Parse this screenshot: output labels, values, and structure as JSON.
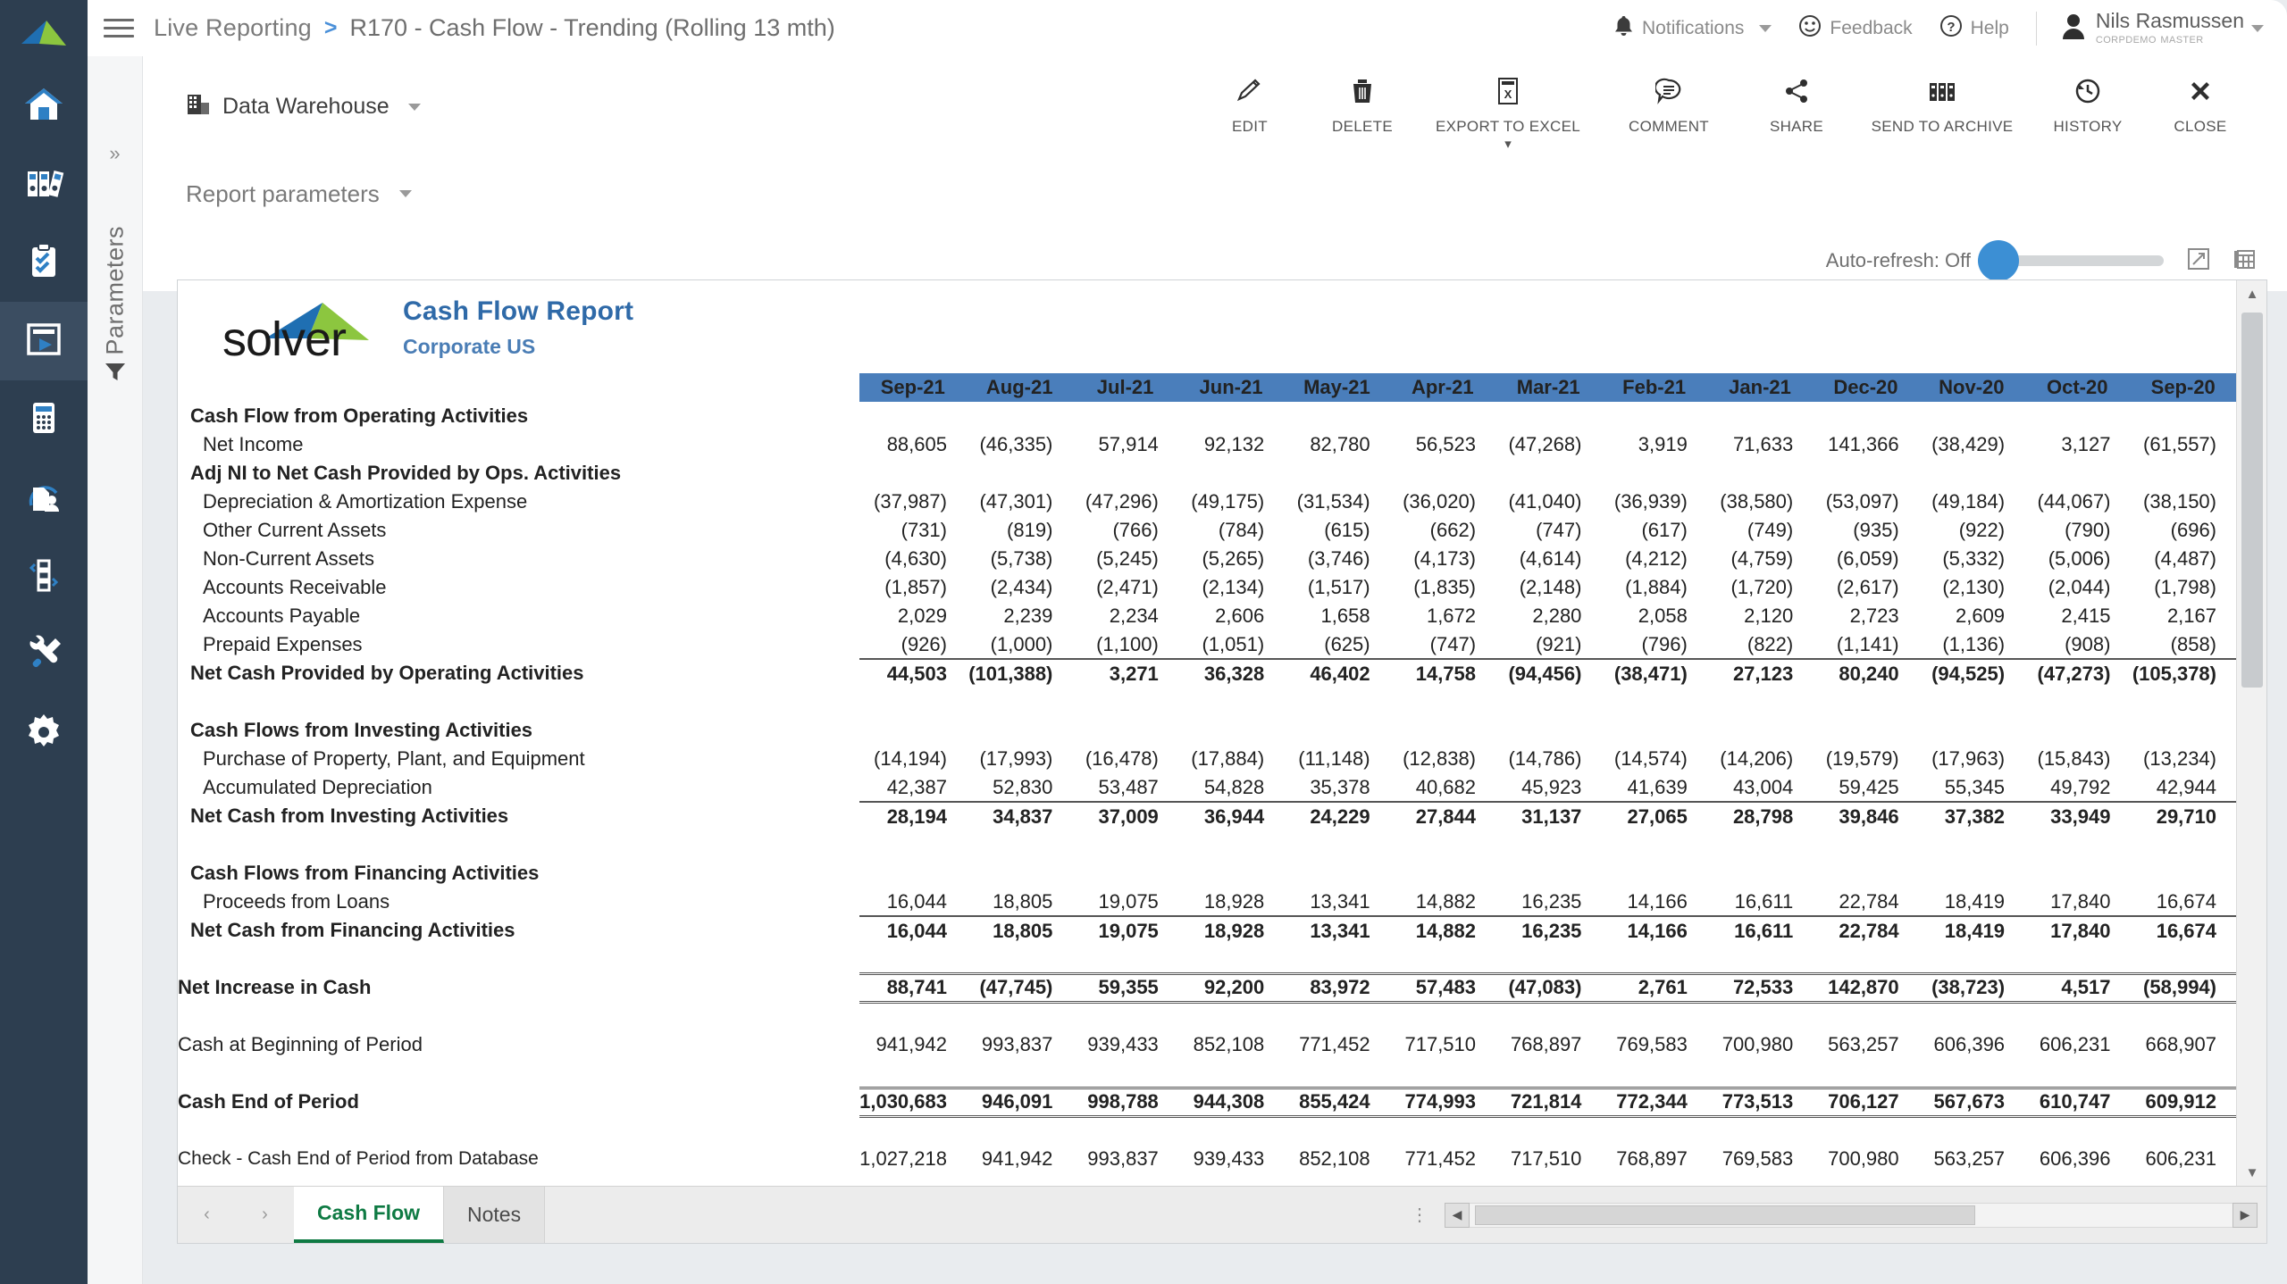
{
  "header": {
    "breadcrumb_root": "Live Reporting",
    "breadcrumb_sep": ">",
    "breadcrumb_current": "R170 - Cash Flow - Trending (Rolling 13 mth)",
    "notifications_label": "Notifications",
    "feedback_label": "Feedback",
    "help_label": "Help",
    "user_name": "Nils Rasmussen",
    "user_role": "CorpDemo Master"
  },
  "toolbar": {
    "datasource_label": "Data Warehouse",
    "actions": [
      {
        "label": "EDIT",
        "icon": "pencil-icon"
      },
      {
        "label": "DELETE",
        "icon": "trash-icon"
      },
      {
        "label": "EXPORT TO EXCEL",
        "icon": "excel-file-icon"
      },
      {
        "label": "COMMENT",
        "icon": "comment-icon"
      },
      {
        "label": "SHARE",
        "icon": "share-icon"
      },
      {
        "label": "SEND TO ARCHIVE",
        "icon": "archive-icon"
      },
      {
        "label": "HISTORY",
        "icon": "history-clock-icon"
      },
      {
        "label": "CLOSE",
        "icon": "close-x-icon"
      }
    ]
  },
  "parameters_panel": {
    "title": "Parameters",
    "expand_glyph": "»"
  },
  "report_parameters": {
    "label": "Report parameters"
  },
  "auto_refresh": {
    "label": "Auto-refresh: Off",
    "state": "Off"
  },
  "report": {
    "brand_word": "solver",
    "title": "Cash Flow Report",
    "subtitle": "Corporate US"
  },
  "tabs": [
    {
      "label": "Cash Flow",
      "active": true
    },
    {
      "label": "Notes",
      "active": false
    }
  ],
  "colors": {
    "header_blue": "#4a7ebb",
    "negative_red": "#e03030",
    "brand_blue": "#2f6aa8",
    "nav_dark": "#2d3e50",
    "tab_green": "#0e7a43"
  },
  "chart_data": {
    "type": "table",
    "title": "Cash Flow Report - Corporate US",
    "columns": [
      "Sep-21",
      "Aug-21",
      "Jul-21",
      "Jun-21",
      "May-21",
      "Apr-21",
      "Mar-21",
      "Feb-21",
      "Jan-21",
      "Dec-20",
      "Nov-20",
      "Oct-20",
      "Sep-20"
    ],
    "rows": [
      {
        "label": "Cash Flow from Operating Activities",
        "style": "section",
        "values": []
      },
      {
        "label": "Net Income",
        "style": "detail",
        "values": [
          "88,605",
          "(46,335)",
          "57,914",
          "92,132",
          "82,780",
          "56,523",
          "(47,268)",
          "3,919",
          "71,633",
          "141,366",
          "(38,429)",
          "3,127",
          "(61,557)"
        ]
      },
      {
        "label": "Adj NI to Net Cash Provided by Ops. Activities",
        "style": "section",
        "values": []
      },
      {
        "label": "Depreciation & Amortization Expense",
        "style": "detail",
        "values": [
          "(37,987)",
          "(47,301)",
          "(47,296)",
          "(49,175)",
          "(31,534)",
          "(36,020)",
          "(41,040)",
          "(36,939)",
          "(38,580)",
          "(53,097)",
          "(49,184)",
          "(44,067)",
          "(38,150)"
        ]
      },
      {
        "label": "Other Current Assets",
        "style": "detail",
        "values": [
          "(731)",
          "(819)",
          "(766)",
          "(784)",
          "(615)",
          "(662)",
          "(747)",
          "(617)",
          "(749)",
          "(935)",
          "(922)",
          "(790)",
          "(696)"
        ]
      },
      {
        "label": "Non-Current Assets",
        "style": "detail",
        "values": [
          "(4,630)",
          "(5,738)",
          "(5,245)",
          "(5,265)",
          "(3,746)",
          "(4,173)",
          "(4,614)",
          "(4,212)",
          "(4,759)",
          "(6,059)",
          "(5,332)",
          "(5,006)",
          "(4,487)"
        ]
      },
      {
        "label": "Accounts Receivable",
        "style": "detail",
        "values": [
          "(1,857)",
          "(2,434)",
          "(2,471)",
          "(2,134)",
          "(1,517)",
          "(1,835)",
          "(2,148)",
          "(1,884)",
          "(1,720)",
          "(2,617)",
          "(2,130)",
          "(2,044)",
          "(1,798)"
        ]
      },
      {
        "label": "Accounts Payable",
        "style": "detail",
        "values": [
          "2,029",
          "2,239",
          "2,234",
          "2,606",
          "1,658",
          "1,672",
          "2,280",
          "2,058",
          "2,120",
          "2,723",
          "2,609",
          "2,415",
          "2,167"
        ]
      },
      {
        "label": "Prepaid Expenses",
        "style": "detail",
        "values": [
          "(926)",
          "(1,000)",
          "(1,100)",
          "(1,051)",
          "(625)",
          "(747)",
          "(921)",
          "(796)",
          "(822)",
          "(1,141)",
          "(1,136)",
          "(908)",
          "(858)"
        ]
      },
      {
        "label": "Net Cash Provided by Operating Activities",
        "style": "total",
        "values": [
          "44,503",
          "(101,388)",
          "3,271",
          "36,328",
          "46,402",
          "14,758",
          "(94,456)",
          "(38,471)",
          "27,123",
          "80,240",
          "(94,525)",
          "(47,273)",
          "(105,378)"
        ]
      },
      {
        "label": "",
        "style": "spacer",
        "values": []
      },
      {
        "label": "Cash Flows from Investing Activities",
        "style": "section",
        "values": []
      },
      {
        "label": "Purchase of Property, Plant, and Equipment",
        "style": "detail",
        "values": [
          "(14,194)",
          "(17,993)",
          "(16,478)",
          "(17,884)",
          "(11,148)",
          "(12,838)",
          "(14,786)",
          "(14,574)",
          "(14,206)",
          "(19,579)",
          "(17,963)",
          "(15,843)",
          "(13,234)"
        ]
      },
      {
        "label": "Accumulated Depreciation",
        "style": "detail",
        "values": [
          "42,387",
          "52,830",
          "53,487",
          "54,828",
          "35,378",
          "40,682",
          "45,923",
          "41,639",
          "43,004",
          "59,425",
          "55,345",
          "49,792",
          "42,944"
        ]
      },
      {
        "label": "Net Cash from Investing Activities",
        "style": "total",
        "values": [
          "28,194",
          "34,837",
          "37,009",
          "36,944",
          "24,229",
          "27,844",
          "31,137",
          "27,065",
          "28,798",
          "39,846",
          "37,382",
          "33,949",
          "29,710"
        ]
      },
      {
        "label": "",
        "style": "spacer",
        "values": []
      },
      {
        "label": "Cash Flows from Financing Activities",
        "style": "section",
        "values": []
      },
      {
        "label": "Proceeds from Loans",
        "style": "detail",
        "values": [
          "16,044",
          "18,805",
          "19,075",
          "18,928",
          "13,341",
          "14,882",
          "16,235",
          "14,166",
          "16,611",
          "22,784",
          "18,419",
          "17,840",
          "16,674"
        ]
      },
      {
        "label": "Net Cash from Financing Activities",
        "style": "total",
        "values": [
          "16,044",
          "18,805",
          "19,075",
          "18,928",
          "13,341",
          "14,882",
          "16,235",
          "14,166",
          "16,611",
          "22,784",
          "18,419",
          "17,840",
          "16,674"
        ]
      },
      {
        "label": "",
        "style": "spacer",
        "values": []
      },
      {
        "label": "Net Increase in Cash",
        "style": "grand",
        "values": [
          "88,741",
          "(47,745)",
          "59,355",
          "92,200",
          "83,972",
          "57,483",
          "(47,083)",
          "2,761",
          "72,533",
          "142,870",
          "(38,723)",
          "4,517",
          "(58,994)"
        ]
      },
      {
        "label": "",
        "style": "spacer",
        "values": []
      },
      {
        "label": "Cash at Beginning of Period",
        "style": "plain",
        "values": [
          "941,942",
          "993,837",
          "939,433",
          "852,108",
          "771,452",
          "717,510",
          "768,897",
          "769,583",
          "700,980",
          "563,257",
          "606,396",
          "606,231",
          "668,907"
        ]
      },
      {
        "label": "",
        "style": "spacer",
        "values": []
      },
      {
        "label": "Cash End of Period",
        "style": "grand",
        "values": [
          "1,030,683",
          "946,091",
          "998,788",
          "944,308",
          "855,424",
          "774,993",
          "721,814",
          "772,344",
          "773,513",
          "706,127",
          "567,673",
          "610,747",
          "609,912"
        ]
      },
      {
        "label": "",
        "style": "spacer",
        "values": []
      },
      {
        "label": "Check - Cash End of Period from Database",
        "style": "plain-small",
        "values": [
          "1,027,218",
          "941,942",
          "993,837",
          "939,433",
          "852,108",
          "771,452",
          "717,510",
          "768,897",
          "769,583",
          "700,980",
          "563,257",
          "606,396",
          "606,231"
        ]
      }
    ]
  },
  "sidebar": {
    "items": [
      {
        "name": "home",
        "icon": "home-icon",
        "active": false
      },
      {
        "name": "archive",
        "icon": "binders-icon",
        "active": false
      },
      {
        "name": "tasks",
        "icon": "clipboard-check-icon",
        "active": false
      },
      {
        "name": "reports",
        "icon": "report-play-icon",
        "active": true
      },
      {
        "name": "budgeting",
        "icon": "calculator-icon",
        "active": false
      },
      {
        "name": "users",
        "icon": "document-person-icon",
        "active": false
      },
      {
        "name": "integrations",
        "icon": "workflow-icon",
        "active": false
      },
      {
        "name": "tools",
        "icon": "wrench-hammer-icon",
        "active": false
      },
      {
        "name": "settings",
        "icon": "gear-icon",
        "active": false
      }
    ]
  }
}
